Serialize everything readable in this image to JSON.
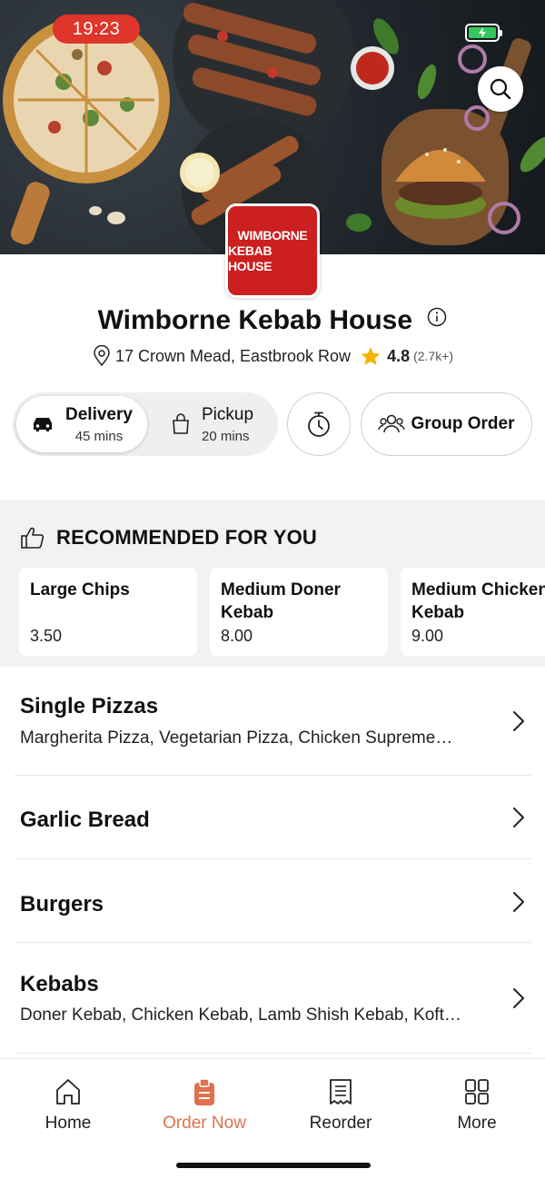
{
  "status_bar": {
    "time": "19:23",
    "battery_color": "#34c759"
  },
  "hero": {
    "logo_line1": "WIMBORNE",
    "logo_line2": "KEBAB HOUSE"
  },
  "restaurant": {
    "name": "Wimborne Kebab House",
    "address": "17 Crown Mead, Eastbrook Row",
    "rating": "4.8",
    "rating_count": "(2.7k+)"
  },
  "order_mode": {
    "delivery": {
      "label": "Delivery",
      "time": "45 mins",
      "selected": true
    },
    "pickup": {
      "label": "Pickup",
      "time": "20 mins",
      "selected": false
    },
    "group_order_label": "Group Order"
  },
  "recommended": {
    "heading": "RECOMMENDED FOR YOU",
    "items": [
      {
        "name_line1": "Large Chips",
        "name_line2": "",
        "price": "3.50"
      },
      {
        "name_line1": "Medium Doner",
        "name_line2": "Kebab",
        "price": "8.00"
      },
      {
        "name_line1": "Medium Chicken",
        "name_line2": "Kebab",
        "price": "9.00"
      }
    ]
  },
  "categories": [
    {
      "title": "Single Pizzas",
      "description": "Margherita Pizza, Vegetarian Pizza, Chicken Supreme…"
    },
    {
      "title": "Garlic Bread",
      "description": ""
    },
    {
      "title": "Burgers",
      "description": ""
    },
    {
      "title": "Kebabs",
      "description": "Doner Kebab, Chicken Kebab, Lamb Shish Kebab, Koft…"
    }
  ],
  "bottom_nav": {
    "items": [
      {
        "label": "Home",
        "icon": "home-icon",
        "active": false
      },
      {
        "label": "Order Now",
        "icon": "order-icon",
        "active": true
      },
      {
        "label": "Reorder",
        "icon": "receipt-icon",
        "active": false
      },
      {
        "label": "More",
        "icon": "grid-icon",
        "active": false
      }
    ],
    "active_color": "#e0714d"
  },
  "colors": {
    "brand_red": "#cc1f1f",
    "star": "#f5b400",
    "accent": "#e0714d"
  }
}
